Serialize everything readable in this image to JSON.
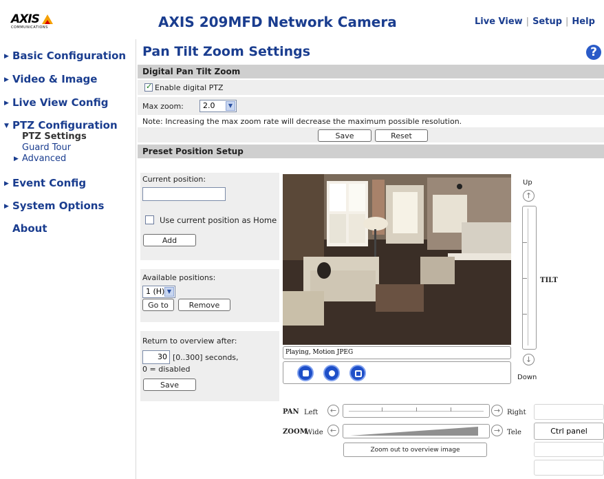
{
  "header": {
    "logo_text": "AXIS",
    "logo_sub": "COMMUNICATIONS",
    "title": "AXIS 209MFD Network Camera",
    "nav": [
      "Live View",
      "Setup",
      "Help"
    ]
  },
  "sidebar": {
    "items": [
      {
        "label": "Basic Configuration",
        "expanded": false
      },
      {
        "label": "Video & Image",
        "expanded": false
      },
      {
        "label": "Live View Config",
        "expanded": false
      },
      {
        "label": "PTZ Configuration",
        "expanded": true
      },
      {
        "label": "Event Config",
        "expanded": false
      },
      {
        "label": "System Options",
        "expanded": false
      },
      {
        "label": "About",
        "expanded": false
      }
    ],
    "ptz_sub": {
      "settings": "PTZ Settings",
      "guard_tour": "Guard Tour",
      "advanced": "Advanced"
    }
  },
  "page": {
    "title": "Pan Tilt Zoom Settings",
    "help_icon": "?"
  },
  "digital_ptz": {
    "heading": "Digital Pan Tilt Zoom",
    "enable_label": "Enable digital PTZ",
    "enable_checked": true,
    "max_zoom_label": "Max zoom:",
    "max_zoom_value": "2.0",
    "note": "Note: Increasing the max zoom rate will decrease the maximum possible resolution.",
    "save": "Save",
    "reset": "Reset"
  },
  "preset": {
    "heading": "Preset Position Setup",
    "current_position_label": "Current position:",
    "current_position_value": "",
    "home_label": "Use current position as Home",
    "home_checked": false,
    "add": "Add",
    "available_label": "Available positions:",
    "available_value": "1 (H)",
    "goto": "Go to",
    "remove": "Remove",
    "return_label": "Return to overview after:",
    "return_value": "30",
    "return_range": "[0..300] seconds,",
    "return_note": "0 = disabled",
    "save": "Save"
  },
  "video": {
    "status": "Playing, Motion JPEG"
  },
  "tilt": {
    "up": "Up",
    "label": "TILT",
    "down": "Down"
  },
  "pan": {
    "label": "PAN",
    "left": "Left",
    "right": "Right"
  },
  "zoom": {
    "label": "ZOOM",
    "wide": "Wide",
    "tele": "Tele",
    "overview_button": "Zoom out to overview image"
  },
  "ctrl_panel": "Ctrl panel",
  "colors": {
    "brand": "#1a3d8f",
    "section_bar": "#cfcfcf",
    "panel_bg": "#eeeeee"
  }
}
